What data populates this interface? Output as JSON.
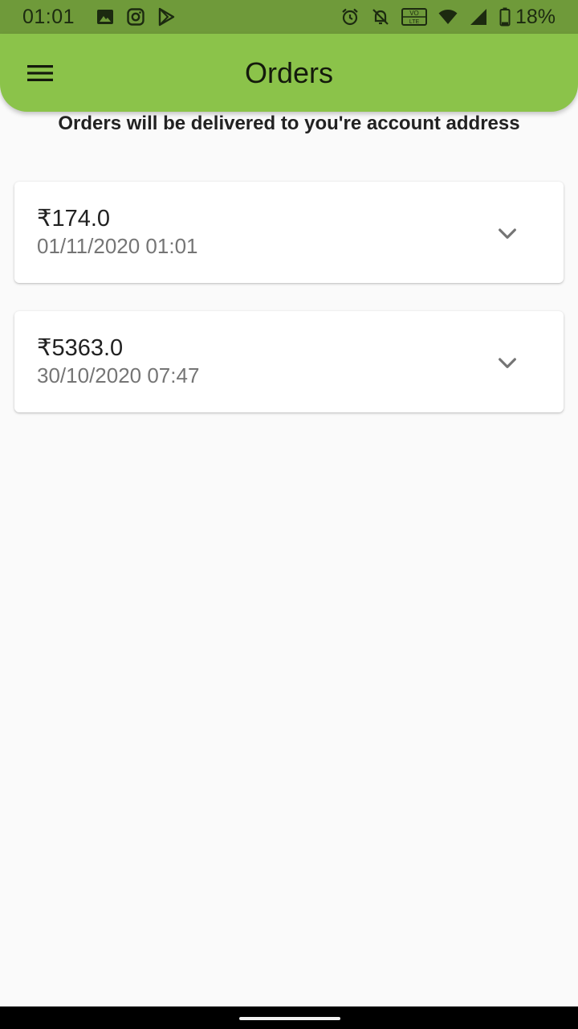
{
  "status_bar": {
    "time": "01:01",
    "battery_percent": "18%",
    "left_icons": [
      "gallery-icon",
      "instagram-icon",
      "play-store-icon"
    ],
    "right_icons": [
      "alarm-icon",
      "bell-off-icon",
      "volte-icon",
      "wifi-icon",
      "signal-icon",
      "battery-icon"
    ],
    "background_color": "#6f9a3a"
  },
  "app_bar": {
    "title": "Orders",
    "menu_icon": "hamburger-menu-icon",
    "background_color": "#8bc34a"
  },
  "delivery_note": "Orders will be delivered to you're account address",
  "orders": [
    {
      "amount": "₹174.0",
      "datetime": "01/11/2020 01:01",
      "expand_icon": "chevron-down-icon"
    },
    {
      "amount": "₹5363.0",
      "datetime": "30/10/2020 07:47",
      "expand_icon": "chevron-down-icon"
    }
  ]
}
